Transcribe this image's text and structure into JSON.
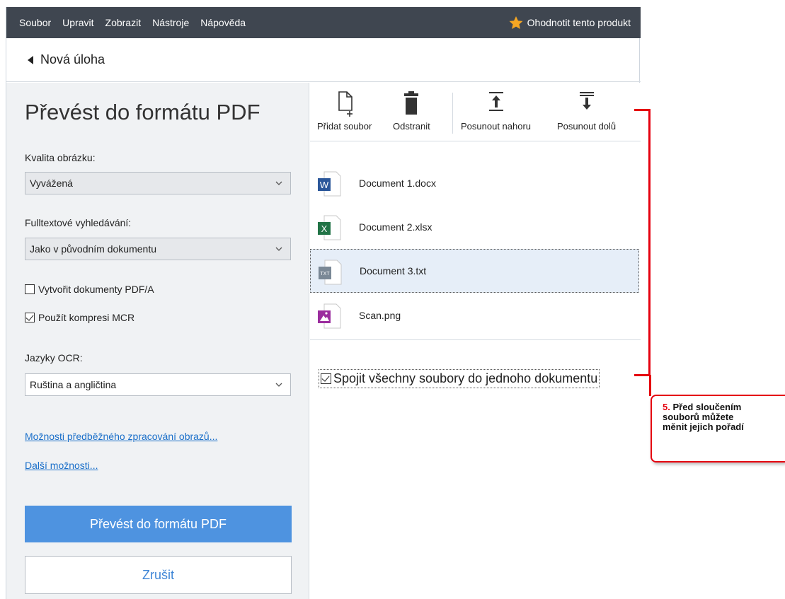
{
  "menu": {
    "items": [
      "Soubor",
      "Upravit",
      "Zobrazit",
      "Nástroje",
      "Nápověda"
    ],
    "rate_label": "Ohodnotit tento produkt",
    "rate_icon": "star-icon",
    "star_color": "#f5a623"
  },
  "nav": {
    "back_label": "Nová úloha",
    "back_icon": "back-triangle-icon"
  },
  "left": {
    "title": "Převést do formátu PDF",
    "quality_label": "Kvalita obrázku:",
    "quality_value": "Vyvážená",
    "search_label": "Fulltextové vyhledávání:",
    "search_value": "Jako v původním dokumentu",
    "pdfa_label": "Vytvořit dokumenty PDF/A",
    "pdfa_checked": false,
    "mrc_label": "Použít kompresi MCR",
    "mrc_checked": true,
    "ocr_label": "Jazyky OCR:",
    "ocr_value": "Ruština a angličtina",
    "link_preprocess": "Možnosti předběžného zpracování obrazů...",
    "link_more": "Další možnosti...",
    "convert_button": "Převést do formátu PDF",
    "cancel_button": "Zrušit",
    "accent_color": "#4e93e0"
  },
  "toolbar": {
    "add_file": "Přidat soubor",
    "remove": "Odstranit",
    "move_up": "Posunout nahoru",
    "move_down": "Posunout dolů"
  },
  "files": [
    {
      "name": "Document 1.docx",
      "icon": "word-file-icon",
      "icon_letter": "W",
      "color": "#2b579a",
      "selected": false
    },
    {
      "name": "Document 2.xlsx",
      "icon": "excel-file-icon",
      "icon_letter": "X",
      "color": "#217346",
      "selected": false
    },
    {
      "name": "Document 3.txt",
      "icon": "text-file-icon",
      "icon_letter": "TXT",
      "color": "#7a8896",
      "selected": true
    },
    {
      "name": "Scan.png",
      "icon": "image-file-icon",
      "icon_letter": "",
      "color": "#9b2d9e",
      "selected": false
    }
  ],
  "merge": {
    "label": "Spojit všechny soubory do jednoho dokumentu",
    "checked": true
  },
  "callout": {
    "number": "5.",
    "line1": "Před sloučením",
    "line2": "souborů můžete",
    "line3": "měnit jejich pořadí",
    "color": "#e5000f"
  }
}
